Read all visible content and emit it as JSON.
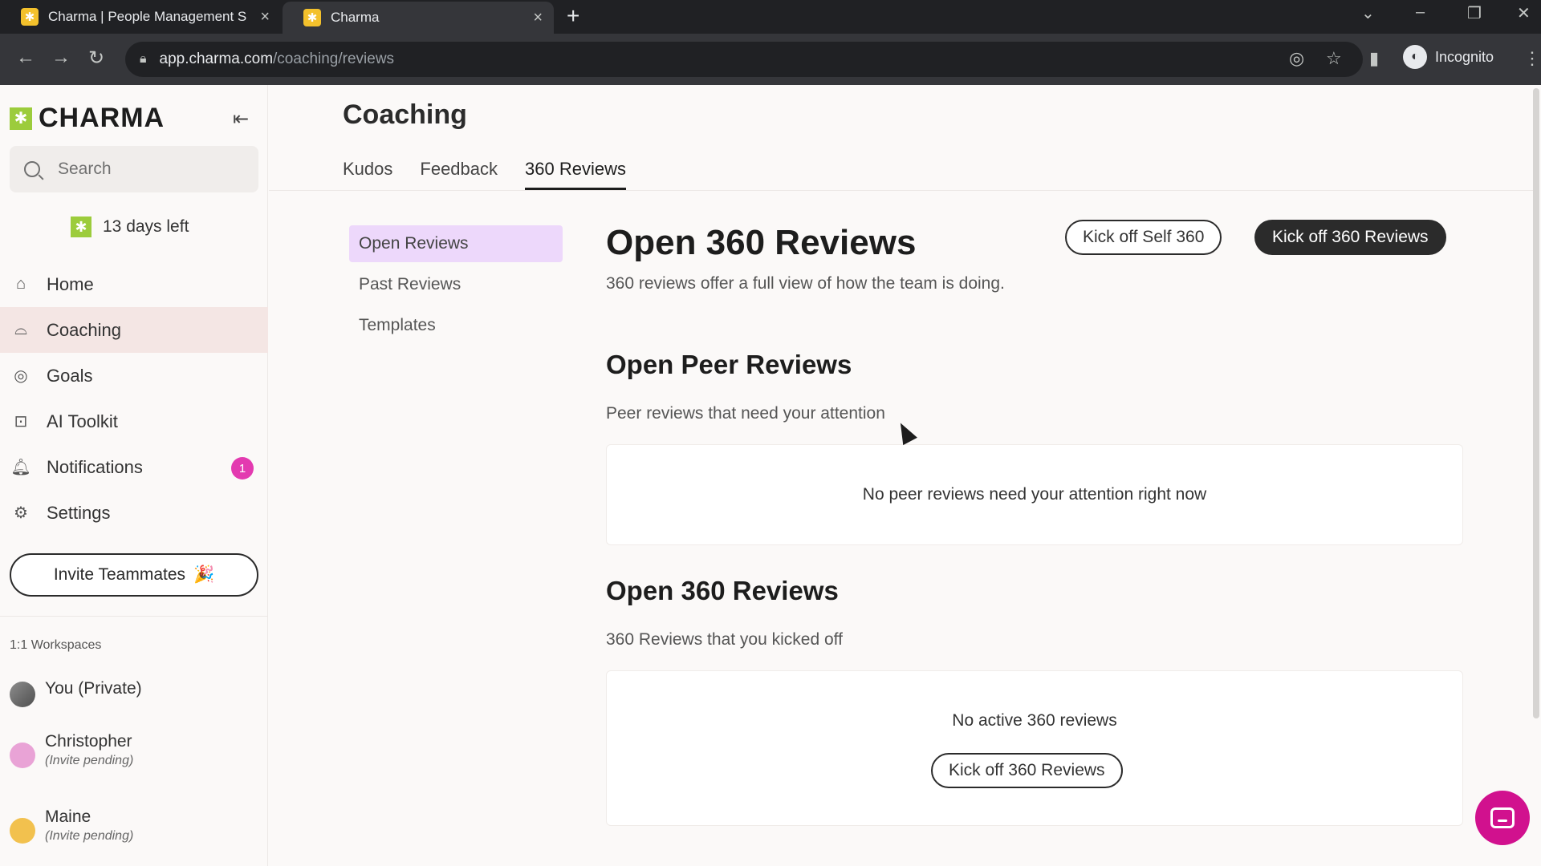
{
  "browser": {
    "tabs": [
      {
        "title": "Charma | People Management S",
        "close": "×"
      },
      {
        "title": "Charma",
        "close": "×"
      }
    ],
    "new_tab": "+",
    "url_host": "app.charma.com",
    "url_path": "/coaching/reviews",
    "profile_label": "Incognito"
  },
  "sidebar": {
    "brand": "CHARMA",
    "search_placeholder": "Search",
    "trial": "13 days left",
    "nav": [
      {
        "label": "Home",
        "icon": "home-icon"
      },
      {
        "label": "Coaching",
        "icon": "coaching-icon",
        "active": true
      },
      {
        "label": "Goals",
        "icon": "goals-icon"
      },
      {
        "label": "AI Toolkit",
        "icon": "robot-icon"
      },
      {
        "label": "Notifications",
        "icon": "bell-icon",
        "badge": "1"
      },
      {
        "label": "Settings",
        "icon": "gear-icon"
      }
    ],
    "invite_label": "Invite Teammates",
    "invite_emoji": "🎉",
    "workspaces_title": "1:1 Workspaces",
    "workspaces": [
      {
        "name": "You (Private)",
        "sub": ""
      },
      {
        "name": "Christopher",
        "sub": "(Invite pending)"
      },
      {
        "name": "Maine",
        "sub": "(Invite pending)"
      }
    ]
  },
  "main": {
    "page_title": "Coaching",
    "tabs": [
      "Kudos",
      "Feedback",
      "360 Reviews"
    ],
    "active_tab": "360 Reviews",
    "subnav": [
      "Open Reviews",
      "Past Reviews",
      "Templates"
    ],
    "heading": "Open 360 Reviews",
    "lead": "360 reviews offer a full view of how the team is doing.",
    "btn_self": "Kick off Self 360",
    "btn_360": "Kick off 360 Reviews",
    "peer": {
      "title": "Open Peer Reviews",
      "subtitle": "Peer reviews that need your attention",
      "empty": "No peer reviews need your attention right now"
    },
    "open360": {
      "title": "Open 360 Reviews",
      "subtitle": "360 Reviews that you kicked off",
      "empty": "No active 360 reviews",
      "button": "Kick off 360 Reviews"
    }
  },
  "colors": {
    "brand_green": "#9ccc3c",
    "active_nav_bg": "#f4e6e4",
    "active_subnav_bg": "#edd8fb",
    "badge": "#e33ab0",
    "chat": "#d1118e"
  }
}
